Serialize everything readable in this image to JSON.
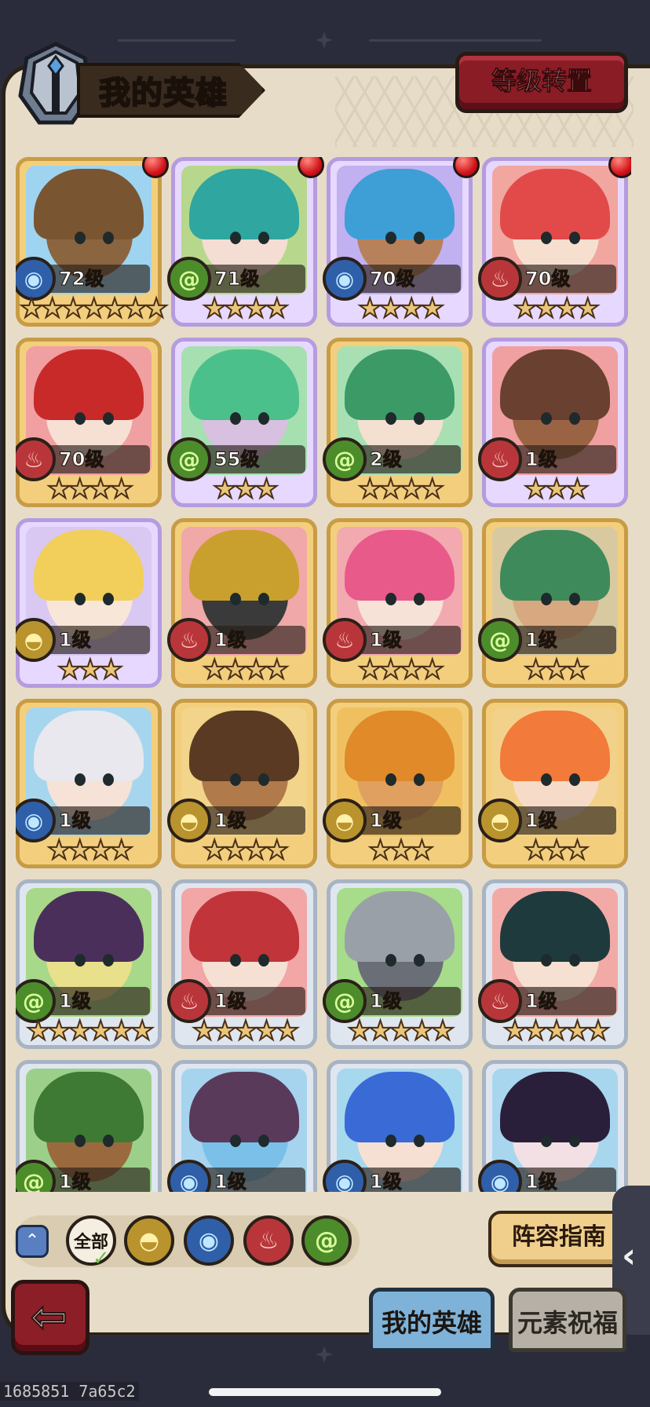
{
  "header": {
    "title": "我的英雄",
    "transfer_button": "等级转置"
  },
  "heroes": [
    {
      "level": "72级",
      "element": "water",
      "stars": 7,
      "frame": "gold",
      "notify": true,
      "bg": "#9ed4f0",
      "hair": "#7a5532",
      "skin": "#8a6540"
    },
    {
      "level": "71级",
      "element": "wood",
      "stars": 4,
      "frame": "purple",
      "notify": true,
      "bg": "#b7d88c",
      "hair": "#2fa6a0",
      "skin": "#f4ddd3"
    },
    {
      "level": "70级",
      "element": "water",
      "stars": 4,
      "frame": "purple",
      "notify": true,
      "bg": "#c1b1f0",
      "hair": "#3d9fd6",
      "skin": "#b7825b"
    },
    {
      "level": "70级",
      "element": "fire",
      "stars": 4,
      "frame": "purple",
      "notify": true,
      "bg": "#f2a6a0",
      "hair": "#e24a4a",
      "skin": "#f7dfd0"
    },
    {
      "level": "70级",
      "element": "fire",
      "stars": 4,
      "frame": "gold",
      "notify": false,
      "bg": "#f0a0a0",
      "hair": "#c82a2a",
      "skin": "#f6e0d4"
    },
    {
      "level": "55级",
      "element": "wood",
      "stars": 3,
      "frame": "purple",
      "notify": false,
      "bg": "#a6e0b0",
      "hair": "#4cc08a",
      "skin": "#d8c0e0"
    },
    {
      "level": "2级",
      "element": "wood",
      "stars": 4,
      "frame": "gold",
      "notify": false,
      "bg": "#a8e0b4",
      "hair": "#3b9a66",
      "skin": "#f4e0d0"
    },
    {
      "level": "1级",
      "element": "fire",
      "stars": 3,
      "frame": "purple",
      "notify": false,
      "bg": "#f0a0a0",
      "hair": "#6a4030",
      "skin": "#9a6444"
    },
    {
      "level": "1级",
      "element": "earth",
      "stars": 3,
      "frame": "purple",
      "notify": false,
      "bg": "#d9c8f2",
      "hair": "#f2cf5a",
      "skin": "#f8e6d8"
    },
    {
      "level": "1级",
      "element": "fire",
      "stars": 4,
      "frame": "gold",
      "notify": false,
      "bg": "#f0a8a8",
      "hair": "#c9a02e",
      "skin": "#3a3a3a"
    },
    {
      "level": "1级",
      "element": "fire",
      "stars": 4,
      "frame": "gold",
      "notify": false,
      "bg": "#f2aab0",
      "hair": "#e85a8a",
      "skin": "#f6e2d6"
    },
    {
      "level": "1级",
      "element": "wood",
      "stars": 3,
      "frame": "gold",
      "notify": false,
      "bg": "#d8c9a0",
      "hair": "#3f8a5a",
      "skin": "#d8a880"
    },
    {
      "level": "1级",
      "element": "water",
      "stars": 4,
      "frame": "gold",
      "notify": false,
      "bg": "#a6d6ee",
      "hair": "#e8e8ee",
      "skin": "#f6e2d6"
    },
    {
      "level": "1级",
      "element": "earth",
      "stars": 4,
      "frame": "gold",
      "notify": false,
      "bg": "#f2d48a",
      "hair": "#5a3a22",
      "skin": "#b07a4a"
    },
    {
      "level": "1级",
      "element": "earth",
      "stars": 3,
      "frame": "gold",
      "notify": false,
      "bg": "#f0c060",
      "hair": "#e08a2a",
      "skin": "#e0a060"
    },
    {
      "level": "1级",
      "element": "earth",
      "stars": 3,
      "frame": "gold",
      "notify": false,
      "bg": "#f2d28a",
      "hair": "#f27a3a",
      "skin": "#f6dcc8"
    },
    {
      "level": "1级",
      "element": "wood",
      "stars": 6,
      "frame": "silver",
      "notify": false,
      "bg": "#a8d88a",
      "hair": "#4a2f5a",
      "skin": "#e8e08a"
    },
    {
      "level": "1级",
      "element": "fire",
      "stars": 5,
      "frame": "silver",
      "notify": false,
      "bg": "#f2a6a6",
      "hair": "#c0343a",
      "skin": "#f6e0d4"
    },
    {
      "level": "1级",
      "element": "wood",
      "stars": 5,
      "frame": "silver",
      "notify": false,
      "bg": "#a6dc8a",
      "hair": "#9aa0a8",
      "skin": "#6a6e76"
    },
    {
      "level": "1级",
      "element": "fire",
      "stars": 5,
      "frame": "silver",
      "notify": false,
      "bg": "#f2aaa6",
      "hair": "#1f3a3c",
      "skin": "#f6e0d2"
    },
    {
      "level": "1级",
      "element": "wood",
      "stars": 0,
      "frame": "silver",
      "notify": false,
      "bg": "#9cd08a",
      "hair": "#3e7a34",
      "skin": "#9a6a3e"
    },
    {
      "level": "1级",
      "element": "water",
      "stars": 0,
      "frame": "silver",
      "notify": false,
      "bg": "#a6d4ee",
      "hair": "#5a3a5a",
      "skin": "#7ac0e8"
    },
    {
      "level": "1级",
      "element": "water",
      "stars": 0,
      "frame": "silver",
      "notify": false,
      "bg": "#a6d8ee",
      "hair": "#3a6ad6",
      "skin": "#f6e0d4"
    },
    {
      "level": "1级",
      "element": "water",
      "stars": 0,
      "frame": "silver",
      "notify": false,
      "bg": "#a8d6ee",
      "hair": "#2a1f3a",
      "skin": "#f2e0e4"
    }
  ],
  "filters": {
    "all_label": "全部",
    "elements": [
      "earth",
      "water",
      "fire",
      "wood"
    ]
  },
  "lineup_guide_button": "阵容指南",
  "tabs": {
    "my_heroes": "我的英雄",
    "element_blessing": "元素祝福"
  },
  "icons": {
    "side_handle": "chevron-left-icon",
    "back": "back-arrow-icon",
    "collapse": "chevron-up-icon"
  },
  "footer_id": "1685851 7a65c2"
}
